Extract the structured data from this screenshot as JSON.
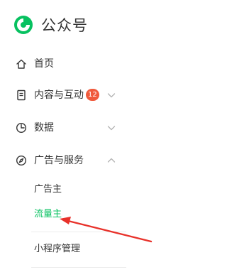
{
  "app": {
    "logo_icon": "wechat-official-account-logo-icon",
    "title": "公众号",
    "brand_color": "#07c160"
  },
  "nav": {
    "home": {
      "label": "首页",
      "icon": "home-icon"
    },
    "content": {
      "label": "内容与互动",
      "icon": "document-icon",
      "badge": "12",
      "expanded": false
    },
    "data": {
      "label": "数据",
      "icon": "pie-chart-icon",
      "expanded": false
    },
    "ads": {
      "label": "广告与服务",
      "icon": "compass-icon",
      "expanded": true,
      "children": [
        {
          "label": "广告主",
          "active": false
        },
        {
          "label": "流量主",
          "active": true
        }
      ]
    },
    "miniprogram": {
      "label": "小程序管理"
    }
  },
  "colors": {
    "badge": "#f05a3c",
    "active_text": "#07c160",
    "annotation_arrow": "#e8312a"
  }
}
